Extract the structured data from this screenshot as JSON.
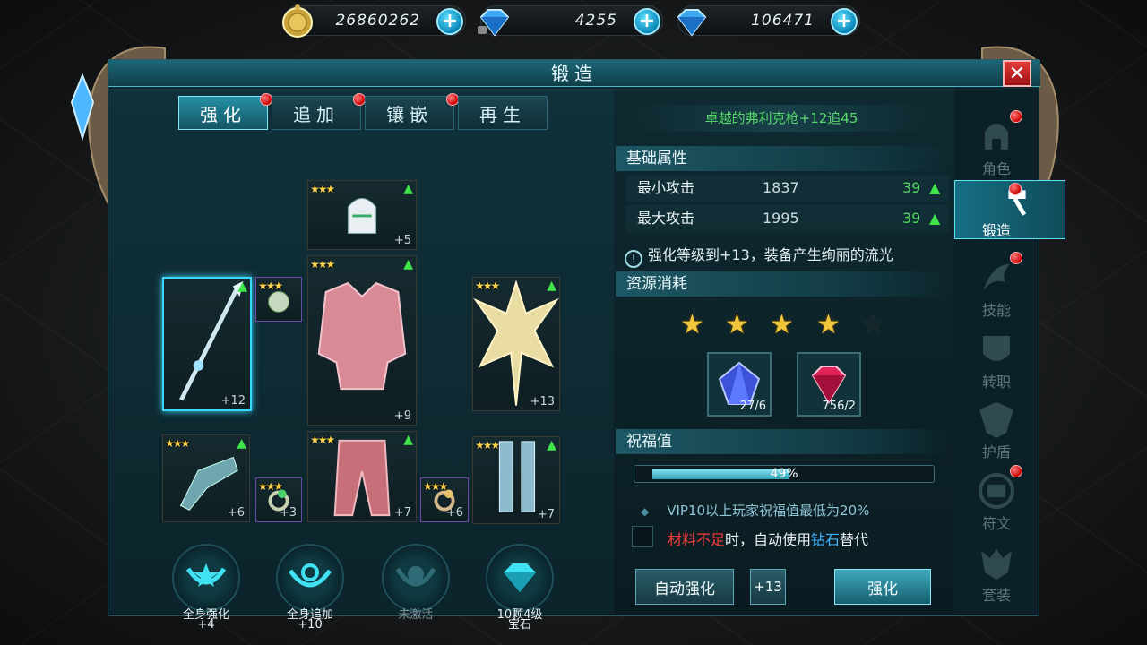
{
  "currencies": [
    {
      "name": "gold",
      "value": "26860262",
      "icon": "gold-coin-icon"
    },
    {
      "name": "bound_diamond",
      "value": "4255",
      "icon": "locked-diamond-icon"
    },
    {
      "name": "diamond",
      "value": "106471",
      "icon": "diamond-icon"
    }
  ],
  "window": {
    "title": "锻造",
    "close": "✕"
  },
  "tabs": [
    {
      "label": "强化",
      "active": true
    },
    {
      "label": "追加"
    },
    {
      "label": "镶嵌"
    },
    {
      "label": "再生"
    }
  ],
  "equipment": {
    "weapon": {
      "level": "+12",
      "stars": "★★★"
    },
    "helmet": {
      "level": "+5",
      "stars": "★★★"
    },
    "armor": {
      "level": "+9",
      "stars": "★★★"
    },
    "wings": {
      "level": "+13",
      "stars": "★★★"
    },
    "necklace": {
      "level": "",
      "stars": "★★★"
    },
    "gloves": {
      "level": "+6",
      "stars": "★★★"
    },
    "ring_left": {
      "level": "+3",
      "stars": "★★★"
    },
    "pants": {
      "level": "+7",
      "stars": "★★★"
    },
    "ring_right": {
      "level": "+6",
      "stars": "★★★"
    },
    "boots": {
      "level": "+7",
      "stars": "★★★"
    }
  },
  "medals": [
    {
      "line1": "全身强化",
      "line2": "+4"
    },
    {
      "line1": "全身追加",
      "line2": "+10"
    },
    {
      "line1": "未激活",
      "line2": ""
    },
    {
      "line1": "10颗4级",
      "line2": "宝石"
    }
  ],
  "item": {
    "name": "卓越的弗利克枪+12追45"
  },
  "base_attr": {
    "title": "基础属性",
    "rows": [
      {
        "name": "最小攻击",
        "value": "1837",
        "increase": "39"
      },
      {
        "name": "最大攻击",
        "value": "1995",
        "increase": "39"
      }
    ],
    "tip": "强化等级到+13，装备产生绚丽的流光"
  },
  "resources": {
    "title": "资源消耗",
    "stars_filled": 4,
    "stars_total": 5,
    "materials": [
      {
        "name": "blue-gem",
        "count": "27/6"
      },
      {
        "name": "red-gem",
        "count": "756/2"
      }
    ]
  },
  "blessing": {
    "title": "祝福值",
    "percent_text": "49%",
    "fill_fraction": 0.49,
    "vip_note": "VIP10以上玩家祝福值最低为20%",
    "auto_part1": "材料不足",
    "auto_part2": "时，自动使用",
    "auto_part3": "钻石",
    "auto_part4": "替代"
  },
  "buttons": {
    "auto": "自动强化",
    "target": "+13",
    "enhance": "强化"
  },
  "sidenav": [
    {
      "label": "角色",
      "badge": true
    },
    {
      "label": "锻造",
      "badge": true,
      "active": true
    },
    {
      "label": "技能",
      "badge": true
    },
    {
      "label": "转职",
      "badge": false
    },
    {
      "label": "护盾",
      "badge": false
    },
    {
      "label": "符文",
      "badge": true
    },
    {
      "label": "套装",
      "badge": false
    }
  ],
  "colors": {
    "accent": "#3ad7ff",
    "up": "#3fe34a",
    "badge": "#cc0000",
    "name_green": "#57d66a"
  }
}
